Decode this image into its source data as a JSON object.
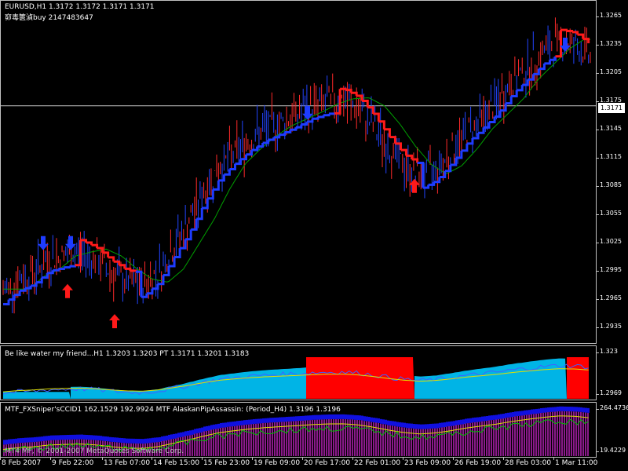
{
  "header": {
    "symbol_line": "EURUSD,H1  1.3172 1.3172 1.3171 1.3171",
    "signal_line": "窌毒篋湞buy 2147483647"
  },
  "main_axis": {
    "labels": [
      "1.3265",
      "1.3235",
      "1.3205",
      "1.3175",
      "1.3145",
      "1.3115",
      "1.3085",
      "1.3055",
      "1.3025",
      "1.2995",
      "1.2965",
      "1.2935"
    ],
    "current_price": "1.3171"
  },
  "indicator1": {
    "text": "Be like water my friend...H1   1.3203  1.3203   PT  1.3171  1.3201  1.3183",
    "axis_top": "1.323",
    "axis_bottom": "1.2969"
  },
  "indicator2": {
    "text": "MTF_FXSniper'sCCID1   162.1529  192.9924  MTF AlaskanPipAssassin: (Period_H4)  1.3196  1.3196",
    "axis_top": "264.4736",
    "axis_bottom": "19.4229",
    "copyright": "MT4 MF, © 2001-2007 MetaQuotes Software Corp."
  },
  "time_axis": {
    "labels": [
      "8 Feb 2007",
      "9 Feb 22:00",
      "13 Feb 07:00",
      "14 Feb 15:00",
      "15 Feb 23:00",
      "19 Feb 09:00",
      "20 Feb 17:00",
      "22 Feb 01:00",
      "23 Feb 09:00",
      "26 Feb 19:00",
      "28 Feb 03:00",
      "1 Mar 11:00"
    ]
  },
  "colors": {
    "bull": "#1e3cff",
    "bear": "#ff1a1a",
    "bars_up": "#2244ff",
    "bars_down": "#ff2a2a",
    "ma_green": "#00a000",
    "ind_fill_cyan": "#00b4e6",
    "ind_fill_red": "#ff0000",
    "ind2_purple": "#8a1a8a"
  },
  "chart_data": {
    "type": "candlestick",
    "symbol": "EURUSD",
    "timeframe": "H1",
    "ylim": [
      1.2935,
      1.3275
    ],
    "current_price": 1.3171,
    "trend_line": [
      1.2985,
      1.2998,
      1.3005,
      1.3018,
      1.3022,
      1.3025,
      1.3018,
      1.3005,
      1.2995,
      1.2992,
      1.3005,
      1.303,
      1.3055,
      1.3085,
      1.311,
      1.3125,
      1.3138,
      1.3148,
      1.3155,
      1.3162,
      1.317,
      1.3175,
      1.3176,
      1.3168,
      1.315,
      1.3128,
      1.311,
      1.31,
      1.3108,
      1.3125,
      1.3145,
      1.316,
      1.3175,
      1.3195,
      1.321,
      1.3225,
      1.3235,
      1.3232,
      1.322
    ],
    "signals": [
      {
        "type": "sell",
        "price": 1.303
      },
      {
        "type": "sell",
        "price": 1.303
      },
      {
        "type": "buy",
        "price": 1.299
      },
      {
        "type": "buy",
        "price": 1.296
      },
      {
        "type": "sell",
        "price": 1.316
      },
      {
        "type": "buy",
        "price": 1.3095
      },
      {
        "type": "sell",
        "price": 1.3228
      }
    ]
  }
}
